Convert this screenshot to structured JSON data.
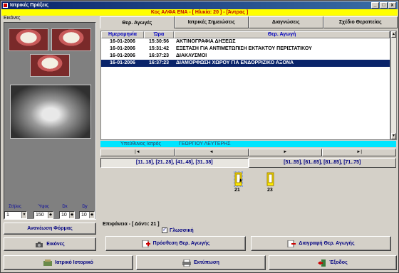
{
  "window": {
    "title": "Ιατρικές Πράξεις",
    "controls": [
      "_",
      "□",
      "x"
    ]
  },
  "patient_bar": "Κος ΑΛΦΑ ΕΝΑ - [ Ηλικία: 20 ] - [Άντρας ]",
  "left_panel": {
    "title": "Εικόνες",
    "controls": {
      "styles_label": "Στήλες",
      "styles_value": "1",
      "height_label": "Ύψος",
      "height_value": "150",
      "dx_label": "Dx",
      "dx_value": "10",
      "dy_label": "Dy",
      "dy_value": "10"
    },
    "refresh_button": "Ανανέωση Φόρμας",
    "images_button": "Εικόνες"
  },
  "tabs": [
    "Θερ. Αγωγές",
    "Ιατρικές Σημειώσεις",
    "Διαγνώσεις",
    "Σχέδιο Θεραπείας"
  ],
  "table": {
    "headers": [
      "Ημερομηνία",
      "Ώρα",
      "Θερ. Αγωγή"
    ],
    "rows": [
      {
        "date": "16-01-2006",
        "time": "15:30:56",
        "treatment": "ΑΚΤΙΝΟΓΡΑΦΙΑ ΔΗΞΕΩΣ"
      },
      {
        "date": "16-01-2006",
        "time": "15:31:42",
        "treatment": "ΕΞΕΤΑΣΗ ΓΙΑ ΑΝΤΙΜΕΤΩΠΙΣΗ ΕΚΤΑΚΤΟΥ ΠΕΡΙΣΤΑΤΙΚΟΥ"
      },
      {
        "date": "16-01-2006",
        "time": "16:37:23",
        "treatment": "ΔΙΑΚΛΥΣΜΟΙ"
      },
      {
        "date": "16-01-2006",
        "time": "16:37:23",
        "treatment": "ΔΙΑΜΟΡΦΩΣΗ ΧΩΡΟΥ ΓΙΑ ΕΝΔΟΡΡΙΖΙΚΟ ΑΞΟΝΑ"
      }
    ]
  },
  "doctor": {
    "label": "Υπεύθυνος Ιατρός",
    "name": "ΓΕΩΡΓΙΟΥ ΛΕΥΤΕΡΗΣ"
  },
  "nav": [
    "|◄",
    "◄",
    "►",
    "►|"
  ],
  "quadrants": [
    "[11..18], [21..28], [41..48], [31..38]",
    "[51..55], [61..65], [81..85], [71..75]"
  ],
  "teeth": [
    {
      "number": "21"
    },
    {
      "number": "23"
    }
  ],
  "surface": "Επιφάνεια - [ Δόντι: 21 ]",
  "tongue_label": "Γλωσσική",
  "tongue_checked": "✓",
  "actions": {
    "add_treatment": "Πρόσθεση Θερ. Αγωγής",
    "delete_treatment": "Διαγραφή Θερ. Αγωγής",
    "history": "Ιατρικό Ιστορικό",
    "print": "Εκτύπωση",
    "exit": "Έξοδος"
  },
  "colors": {
    "selected_row": "#0a246a",
    "patient_bar": "#ffff00",
    "doctor_bar": "#00e5ff"
  }
}
